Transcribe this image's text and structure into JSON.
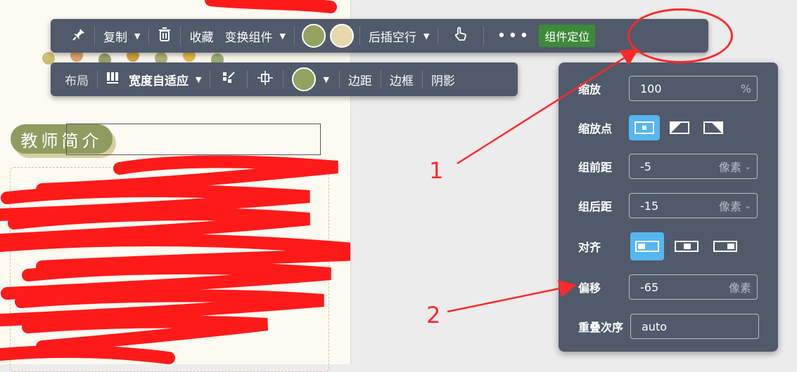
{
  "toolbar_main": {
    "pin_icon": "pin-icon",
    "copy_label": "复制",
    "delete_icon": "trash-icon",
    "favorite_label": "收藏",
    "switch_component_label": "变换组件",
    "color_swatch_1": "#93a261",
    "color_swatch_2": "#e6d9ae",
    "insert_after_label": "后插空行",
    "pointer_icon": "hand-pointer-icon",
    "more_icon": "more-dots-icon",
    "component_position_label": "组件定位"
  },
  "toolbar_layout": {
    "layout_label": "布局",
    "columns_icon": "columns-icon",
    "width_mode_label": "宽度自适应",
    "style_brush_icon": "style-brush-icon",
    "align_icon": "align-center-icon",
    "color_swatch": "#93a261",
    "margin_label": "边距",
    "border_label": "边框",
    "shadow_label": "阴影"
  },
  "panel": {
    "scale": {
      "label": "缩放",
      "value": "100",
      "unit": "%"
    },
    "scale_origin": {
      "label": "缩放点"
    },
    "spacing_before": {
      "label": "组前距",
      "value": "-5",
      "unit": "像素"
    },
    "spacing_after": {
      "label": "组后距",
      "value": "-15",
      "unit": "像素"
    },
    "align": {
      "label": "对齐"
    },
    "offset": {
      "label": "偏移",
      "value": "-65",
      "unit": "像素"
    },
    "z_order": {
      "label": "重叠次序",
      "value": "auto"
    }
  },
  "document": {
    "section_title": "教师简介"
  },
  "annotations": {
    "label_1": "1",
    "label_2": "2",
    "color": "#ff2a2a"
  }
}
